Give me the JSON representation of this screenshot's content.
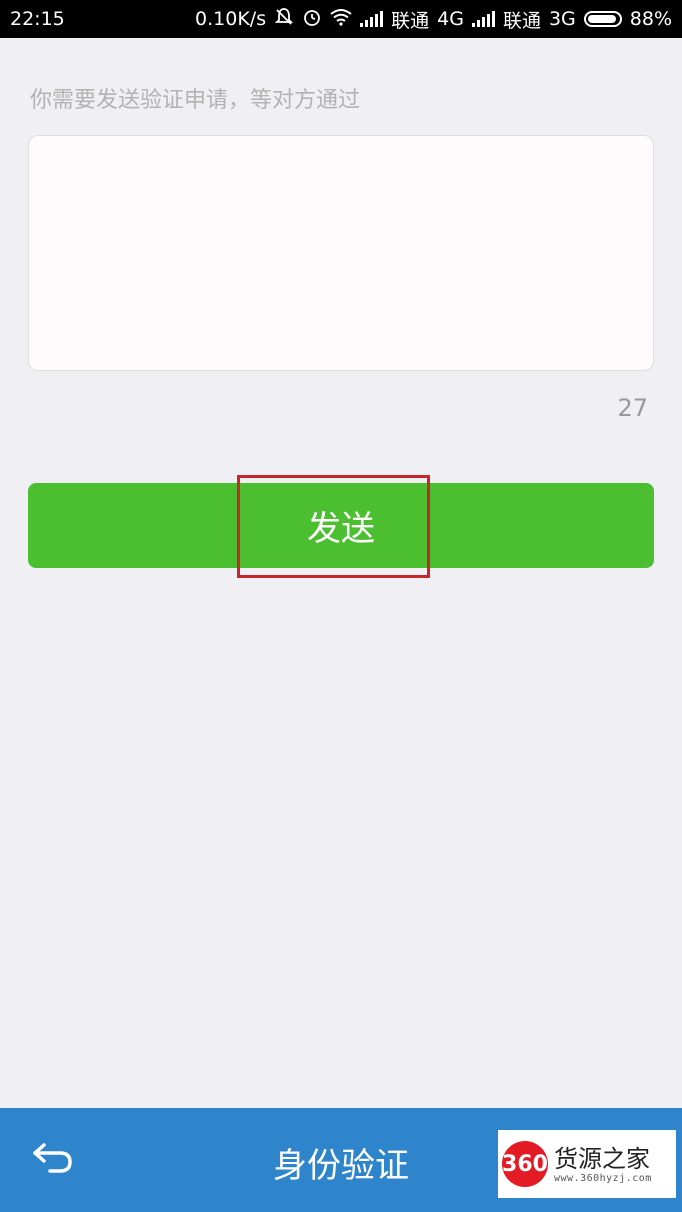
{
  "status_bar": {
    "time": "22:15",
    "speed": "0.10K/s",
    "carrier1": "联通",
    "network1": "4G",
    "carrier2": "联通",
    "network2": "3G",
    "battery": "88%"
  },
  "form": {
    "hint": "你需要发送验证申请，等对方通过",
    "message_value": "",
    "char_count": "27",
    "send_label": "发送"
  },
  "bottom_bar": {
    "title": "身份验证"
  },
  "watermark": {
    "logo_text": "360",
    "name": "货源之家",
    "url": "www.360hyzj.com"
  },
  "colors": {
    "accent_green": "#4cbf30",
    "bottom_blue": "#2f85cc",
    "highlight_red": "#c9262c"
  }
}
